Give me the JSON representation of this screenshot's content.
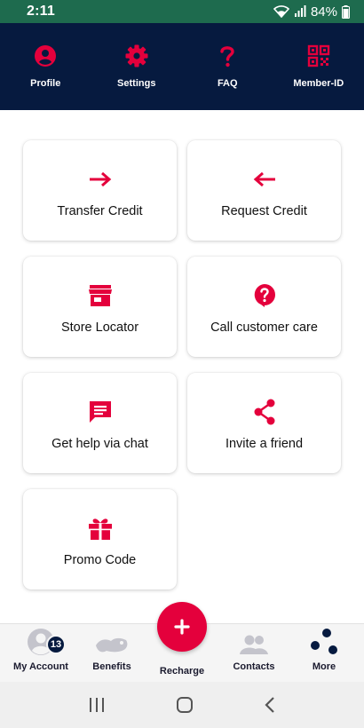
{
  "status_bar": {
    "time": "2:11",
    "battery": "84%"
  },
  "top_nav": [
    {
      "label": "Profile",
      "icon": "profile-icon"
    },
    {
      "label": "Settings",
      "icon": "gear-icon"
    },
    {
      "label": "FAQ",
      "icon": "question-mark-icon"
    },
    {
      "label": "Member-ID",
      "icon": "qr-code-icon"
    }
  ],
  "cards": [
    {
      "label": "Transfer Credit",
      "icon": "arrow-right-icon"
    },
    {
      "label": "Request Credit",
      "icon": "arrow-left-icon"
    },
    {
      "label": "Store Locator",
      "icon": "store-icon"
    },
    {
      "label": "Call customer care",
      "icon": "help-bubble-icon"
    },
    {
      "label": "Get help via chat",
      "icon": "chat-icon"
    },
    {
      "label": "Invite a friend",
      "icon": "share-icon"
    },
    {
      "label": "Promo Code",
      "icon": "gift-icon"
    }
  ],
  "bottom_nav": {
    "my_account": {
      "label": "My Account",
      "badge": "13"
    },
    "benefits": {
      "label": "Benefits"
    },
    "recharge": {
      "label": "Recharge"
    },
    "contacts": {
      "label": "Contacts"
    },
    "more": {
      "label": "More"
    }
  },
  "colors": {
    "accent": "#e4003c",
    "header_bg": "#061a3f",
    "status_bar": "#1e6b4e"
  }
}
